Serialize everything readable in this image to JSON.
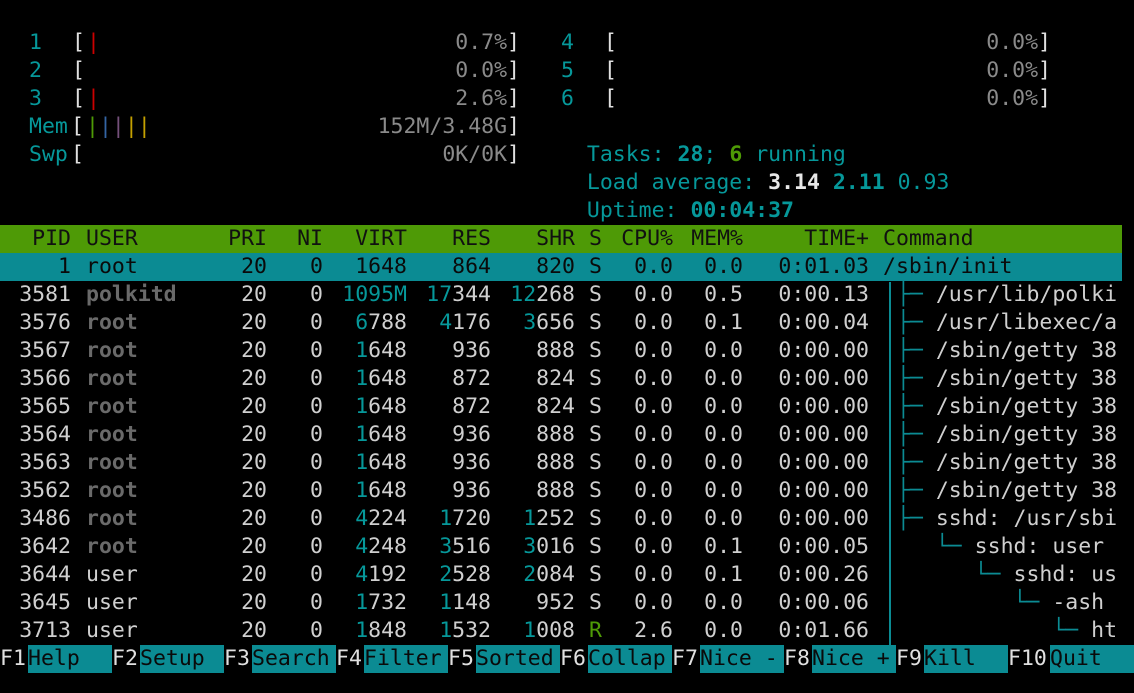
{
  "meters": {
    "cpus_left": [
      {
        "id": "1",
        "bar": "|",
        "value": "0.7%"
      },
      {
        "id": "2",
        "bar": "",
        "value": "0.0%"
      },
      {
        "id": "3",
        "bar": "|",
        "value": "2.6%"
      }
    ],
    "cpus_right": [
      {
        "id": "4",
        "bar": "",
        "value": "0.0%"
      },
      {
        "id": "5",
        "bar": "",
        "value": "0.0%"
      },
      {
        "id": "6",
        "bar": "",
        "value": "0.0%"
      }
    ],
    "mem": {
      "label": "Mem",
      "value": "152M/3.48G"
    },
    "swp": {
      "label": "Swp",
      "value": "0K/0K"
    },
    "tasks": {
      "label": "Tasks:",
      "count": "28",
      "sep": ";",
      "running": "6",
      "running_label": "running"
    },
    "load": {
      "label": "Load average:",
      "l1": "3.14",
      "l5": "2.11",
      "l15": "0.93"
    },
    "uptime": {
      "label": "Uptime:",
      "value": "00:04:37"
    }
  },
  "columns": [
    "PID",
    "USER",
    "PRI",
    "NI",
    "VIRT",
    "RES",
    "SHR",
    "S",
    "CPU%",
    "MEM%",
    "TIME+",
    "Command"
  ],
  "processes": [
    {
      "pid": "1",
      "user": "root",
      "pri": "20",
      "ni": "0",
      "virt": "1648",
      "res": "864",
      "shr": "820",
      "s": "S",
      "cpu": "0.0",
      "mem": "0.0",
      "time": "0:01.03",
      "cmd": "/sbin/init"
    },
    {
      "pid": "3581",
      "user": "polkitd",
      "pri": "20",
      "ni": "0",
      "virt": "1095M",
      "res": "17344",
      "shr": "12268",
      "s": "S",
      "cpu": "0.0",
      "mem": "0.5",
      "time": "0:00.13",
      "cmd": "├─ /usr/lib/polki"
    },
    {
      "pid": "3576",
      "user": "root",
      "pri": "20",
      "ni": "0",
      "virt": "6788",
      "res": "4176",
      "shr": "3656",
      "s": "S",
      "cpu": "0.0",
      "mem": "0.1",
      "time": "0:00.04",
      "cmd": "├─ /usr/libexec/a"
    },
    {
      "pid": "3567",
      "user": "root",
      "pri": "20",
      "ni": "0",
      "virt": "1648",
      "res": "936",
      "shr": "888",
      "s": "S",
      "cpu": "0.0",
      "mem": "0.0",
      "time": "0:00.00",
      "cmd": "├─ /sbin/getty 38"
    },
    {
      "pid": "3566",
      "user": "root",
      "pri": "20",
      "ni": "0",
      "virt": "1648",
      "res": "872",
      "shr": "824",
      "s": "S",
      "cpu": "0.0",
      "mem": "0.0",
      "time": "0:00.00",
      "cmd": "├─ /sbin/getty 38"
    },
    {
      "pid": "3565",
      "user": "root",
      "pri": "20",
      "ni": "0",
      "virt": "1648",
      "res": "872",
      "shr": "824",
      "s": "S",
      "cpu": "0.0",
      "mem": "0.0",
      "time": "0:00.00",
      "cmd": "├─ /sbin/getty 38"
    },
    {
      "pid": "3564",
      "user": "root",
      "pri": "20",
      "ni": "0",
      "virt": "1648",
      "res": "936",
      "shr": "888",
      "s": "S",
      "cpu": "0.0",
      "mem": "0.0",
      "time": "0:00.00",
      "cmd": "├─ /sbin/getty 38"
    },
    {
      "pid": "3563",
      "user": "root",
      "pri": "20",
      "ni": "0",
      "virt": "1648",
      "res": "936",
      "shr": "888",
      "s": "S",
      "cpu": "0.0",
      "mem": "0.0",
      "time": "0:00.00",
      "cmd": "├─ /sbin/getty 38"
    },
    {
      "pid": "3562",
      "user": "root",
      "pri": "20",
      "ni": "0",
      "virt": "1648",
      "res": "936",
      "shr": "888",
      "s": "S",
      "cpu": "0.0",
      "mem": "0.0",
      "time": "0:00.00",
      "cmd": "├─ /sbin/getty 38"
    },
    {
      "pid": "3486",
      "user": "root",
      "pri": "20",
      "ni": "0",
      "virt": "4224",
      "res": "1720",
      "shr": "1252",
      "s": "S",
      "cpu": "0.0",
      "mem": "0.0",
      "time": "0:00.00",
      "cmd": "├─ sshd: /usr/sbi"
    },
    {
      "pid": "3642",
      "user": "root",
      "pri": "20",
      "ni": "0",
      "virt": "4248",
      "res": "3516",
      "shr": "3016",
      "s": "S",
      "cpu": "0.0",
      "mem": "0.1",
      "time": "0:00.05",
      "cmd": "   └─ sshd: user"
    },
    {
      "pid": "3644",
      "user": "user",
      "pri": "20",
      "ni": "0",
      "virt": "4192",
      "res": "2528",
      "shr": "2084",
      "s": "S",
      "cpu": "0.0",
      "mem": "0.1",
      "time": "0:00.26",
      "cmd": "      └─ sshd: us"
    },
    {
      "pid": "3645",
      "user": "user",
      "pri": "20",
      "ni": "0",
      "virt": "1732",
      "res": "1148",
      "shr": "952",
      "s": "S",
      "cpu": "0.0",
      "mem": "0.0",
      "time": "0:00.06",
      "cmd": "         └─ -ash"
    },
    {
      "pid": "3713",
      "user": "user",
      "pri": "20",
      "ni": "0",
      "virt": "1848",
      "res": "1532",
      "shr": "1008",
      "s": "R",
      "cpu": "2.6",
      "mem": "0.0",
      "time": "0:01.66",
      "cmd": "            └─ ht"
    }
  ],
  "function_keys": [
    {
      "key": "F1",
      "label": "Help  "
    },
    {
      "key": "F2",
      "label": "Setup "
    },
    {
      "key": "F3",
      "label": "Search"
    },
    {
      "key": "F4",
      "label": "Filter"
    },
    {
      "key": "F5",
      "label": "Sorted"
    },
    {
      "key": "F6",
      "label": "Collap"
    },
    {
      "key": "F7",
      "label": "Nice -"
    },
    {
      "key": "F8",
      "label": "Nice +"
    },
    {
      "key": "F9",
      "label": "Kill  "
    },
    {
      "key": "F10",
      "label": "Quit  "
    }
  ],
  "colors": {
    "header_bg": "#4e9a06",
    "selected_bg": "#0b8b93",
    "cyan": "#06989a",
    "red": "#cc0000"
  }
}
